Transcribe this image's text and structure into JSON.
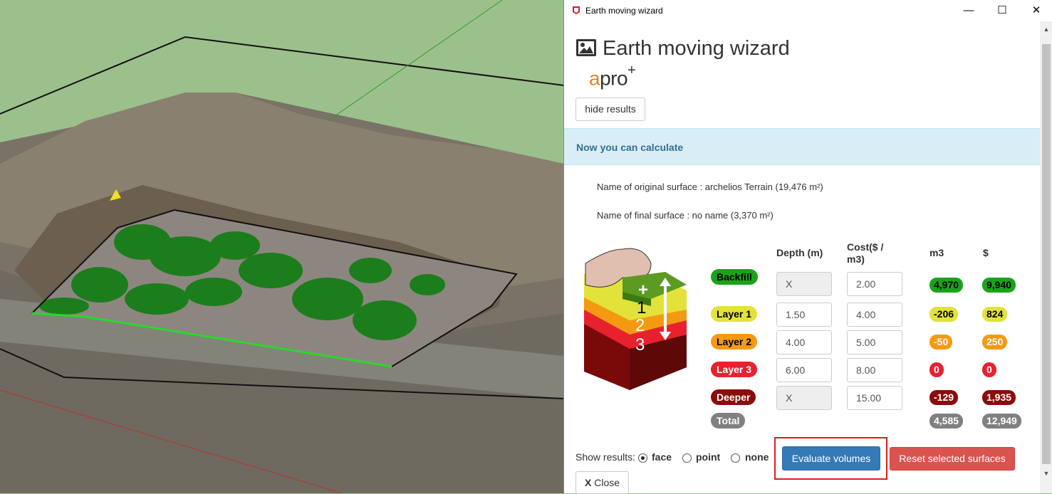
{
  "window": {
    "title": "Earth moving wizard",
    "min": "—",
    "max": "☐",
    "close": "✕"
  },
  "header": {
    "title": "Earth moving wizard",
    "logo_a": "a",
    "logo_rest": "pro",
    "logo_plus": "+"
  },
  "buttons": {
    "hide_results": "hide results",
    "evaluate": "Evaluate volumes",
    "reset": "Reset selected surfaces",
    "close_x": "X",
    "close": "Close"
  },
  "alert": "Now you can calculate",
  "info": {
    "original": "Name of original surface : archelios Terrain  (19,476 m²)",
    "final": "Name of final surface : no name  (3,370 m²)"
  },
  "columns": {
    "depth": "Depth (m)",
    "cost": "Cost($ / m3)",
    "cost_line1": "Cost($ /",
    "cost_line2": "m3)",
    "m3": "m3",
    "usd": "$"
  },
  "rows": [
    {
      "label": "Backfill",
      "color": "#1aa31a",
      "depth": "X",
      "cost": "2.00",
      "m3": "4,970",
      "usd": "9,940"
    },
    {
      "label": "Layer 1",
      "color": "#e2e23a",
      "depth": "1.50",
      "cost": "4.00",
      "m3": "-206",
      "usd": "824"
    },
    {
      "label": "Layer 2",
      "color": "#f49a12",
      "depth": "4.00",
      "cost": "5.00",
      "m3": "-50",
      "usd": "250"
    },
    {
      "label": "Layer 3",
      "color": "#e8212e",
      "depth": "6.00",
      "cost": "8.00",
      "m3": "0",
      "usd": "0"
    },
    {
      "label": "Deeper",
      "color": "#8b0c0c",
      "depth": "X",
      "cost": "15.00",
      "m3": "-129",
      "usd": "1,935"
    }
  ],
  "total": {
    "label": "Total",
    "color": "#808080",
    "m3": "4,585",
    "usd": "12,949"
  },
  "show_results": {
    "label": "Show results:",
    "options": [
      "face",
      "point",
      "none"
    ],
    "selected": "face"
  },
  "diagram": {
    "plus": "+",
    "n1": "1",
    "n2": "2",
    "n3": "3"
  }
}
